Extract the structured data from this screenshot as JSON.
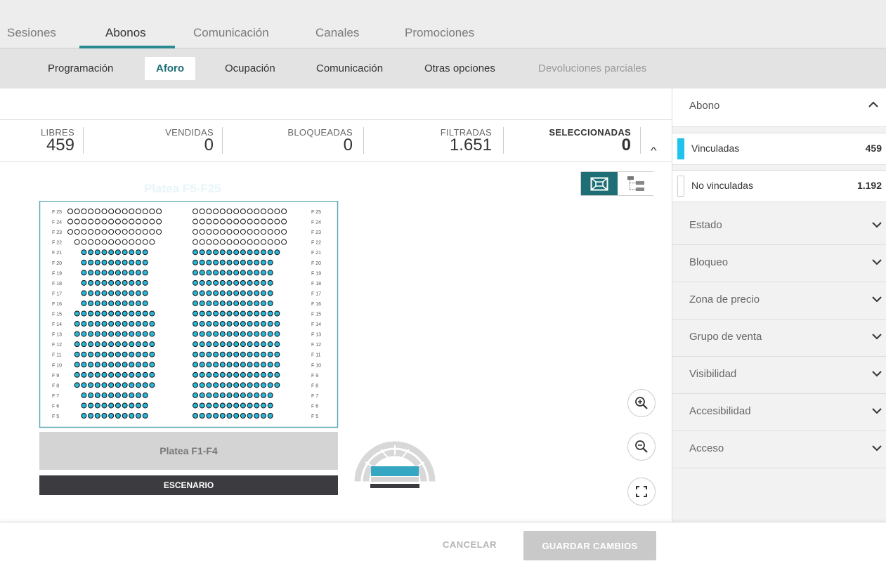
{
  "tabs": [
    {
      "label": "Sesiones",
      "active": false
    },
    {
      "label": "Abonos",
      "active": true
    },
    {
      "label": "Comunicación",
      "active": false
    },
    {
      "label": "Canales",
      "active": false
    },
    {
      "label": "Promociones",
      "active": false
    }
  ],
  "subtabs": [
    {
      "label": "Programación",
      "state": "normal"
    },
    {
      "label": "Aforo",
      "state": "active"
    },
    {
      "label": "Ocupación",
      "state": "normal"
    },
    {
      "label": "Comunicación",
      "state": "normal"
    },
    {
      "label": "Otras opciones",
      "state": "normal"
    },
    {
      "label": "Devoluciones parciales",
      "state": "disabled"
    }
  ],
  "stats": {
    "libres": {
      "label": "LIBRES",
      "value": "459"
    },
    "vendidas": {
      "label": "VENDIDAS",
      "value": "0"
    },
    "bloqueadas": {
      "label": "BLOQUEADAS",
      "value": "0"
    },
    "filtradas": {
      "label": "FILTRADAS",
      "value": "1.651"
    },
    "seleccionadas": {
      "label": "SELECCIONADAS",
      "value": "0"
    }
  },
  "seatmap": {
    "zone_title": "Platea F5-F25",
    "lower_zone": "Platea F1-F4",
    "stage": "ESCENARIO",
    "colors": {
      "linked": "#29b6d8",
      "unlinked": "#ffffff",
      "stage": "#3b3b40",
      "lower_zone": "#d4d4d4",
      "border": "#5fa9b3"
    },
    "rows": [
      {
        "label": "F 25",
        "left": [
          0,
          14
        ],
        "right": [
          0,
          14
        ],
        "linked": false
      },
      {
        "label": "F 24",
        "left": [
          0,
          14
        ],
        "right": [
          0,
          14
        ],
        "linked": false
      },
      {
        "label": "F 23",
        "left": [
          0,
          14
        ],
        "right": [
          0,
          14
        ],
        "linked": false
      },
      {
        "label": "F 22",
        "left": [
          1,
          13
        ],
        "right": [
          0,
          14
        ],
        "linked": false
      },
      {
        "label": "F 21",
        "left": [
          2,
          12
        ],
        "right": [
          0,
          13
        ],
        "linked": true
      },
      {
        "label": "F 20",
        "left": [
          2,
          12
        ],
        "right": [
          0,
          12
        ],
        "linked": true
      },
      {
        "label": "F 19",
        "left": [
          2,
          12
        ],
        "right": [
          0,
          12
        ],
        "linked": true
      },
      {
        "label": "F 18",
        "left": [
          2,
          12
        ],
        "right": [
          0,
          12
        ],
        "linked": true
      },
      {
        "label": "F 17",
        "left": [
          2,
          12
        ],
        "right": [
          0,
          12
        ],
        "linked": true
      },
      {
        "label": "F 16",
        "left": [
          2,
          12
        ],
        "right": [
          0,
          12
        ],
        "linked": true
      },
      {
        "label": "F 15",
        "left": [
          1,
          13
        ],
        "right": [
          0,
          13
        ],
        "linked": true
      },
      {
        "label": "F 14",
        "left": [
          1,
          13
        ],
        "right": [
          0,
          13
        ],
        "linked": true
      },
      {
        "label": "F 13",
        "left": [
          1,
          13
        ],
        "right": [
          0,
          13
        ],
        "linked": true
      },
      {
        "label": "F 12",
        "left": [
          1,
          13
        ],
        "right": [
          0,
          13
        ],
        "linked": true
      },
      {
        "label": "F 11",
        "left": [
          1,
          13
        ],
        "right": [
          0,
          13
        ],
        "linked": true
      },
      {
        "label": "F 10",
        "left": [
          1,
          13
        ],
        "right": [
          0,
          13
        ],
        "linked": true
      },
      {
        "label": "F 9",
        "left": [
          1,
          13
        ],
        "right": [
          0,
          13
        ],
        "linked": true
      },
      {
        "label": "F 8",
        "left": [
          1,
          13
        ],
        "right": [
          0,
          13
        ],
        "linked": true
      },
      {
        "label": "F 7",
        "left": [
          2,
          12
        ],
        "right": [
          0,
          12
        ],
        "linked": true
      },
      {
        "label": "F 6",
        "left": [
          2,
          12
        ],
        "right": [
          0,
          12
        ],
        "linked": true
      },
      {
        "label": "F 5",
        "left": [
          2,
          12
        ],
        "right": [
          0,
          12
        ],
        "linked": true
      }
    ]
  },
  "sidebar": {
    "header": "Abono",
    "filters": [
      {
        "label": "Vinculadas",
        "count": "459",
        "color": "#1fc3ee"
      },
      {
        "label": "No vinculadas",
        "count": "1.192",
        "color": "#ffffff"
      }
    ],
    "accordions": [
      "Estado",
      "Bloqueo",
      "Zona de precio",
      "Grupo de venta",
      "Visibilidad",
      "Accesibilidad",
      "Acceso"
    ]
  },
  "footer": {
    "cancel": "CANCELAR",
    "save": "GUARDAR CAMBIOS"
  },
  "icons": {
    "view_map": "map-view-icon",
    "view_tree": "tree-view-icon",
    "zoom_in": "zoom-in-icon",
    "zoom_out": "zoom-out-icon",
    "fullscreen": "fullscreen-icon"
  }
}
